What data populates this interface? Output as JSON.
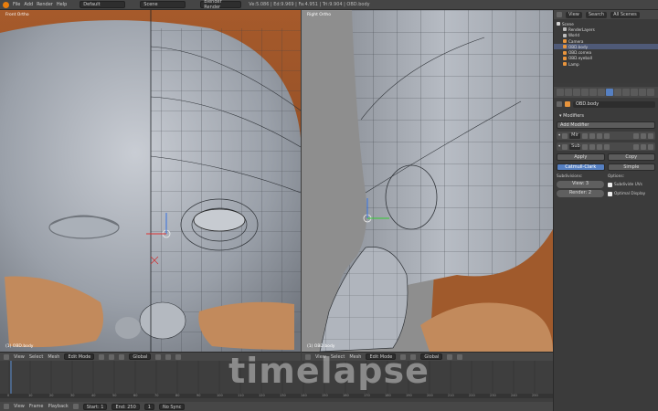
{
  "topbar": {
    "menus": [
      "File",
      "Add",
      "Render",
      "Help"
    ],
    "layout": "Default",
    "scene": "Scene",
    "engine": "Blender Render",
    "stats": "Ve:5.086 | Ed:9.969 | Fa:4.951 | Tri:9.904 | OBD.body"
  },
  "left_view": {
    "label": "Front Ortho",
    "object": "(1) OBD.body"
  },
  "right_view": {
    "label": "Right Ortho",
    "object": "(1) OBD.body"
  },
  "view_header": {
    "menus": [
      "View",
      "Select",
      "Mesh"
    ],
    "mode": "Edit Mode",
    "orientation": "Global"
  },
  "timeline": {
    "overlay": "timelapse",
    "ruler": [
      "0",
      "10",
      "20",
      "30",
      "40",
      "50",
      "60",
      "70",
      "80",
      "90",
      "100",
      "110",
      "120",
      "130",
      "140",
      "150",
      "160",
      "170",
      "180",
      "190",
      "200",
      "210",
      "220",
      "230",
      "240",
      "250"
    ],
    "menus": [
      "View",
      "Frame",
      "Playback"
    ],
    "start": "Start: 1",
    "end": "End: 250",
    "current": "1",
    "sync": "No Sync"
  },
  "outliner": {
    "tabs": [
      "View",
      "Search",
      "All Scenes"
    ],
    "items": [
      {
        "label": "Scene",
        "indent": 0,
        "color": "#d3d3d3"
      },
      {
        "label": "RenderLayers",
        "indent": 1,
        "color": "#bbbbbb"
      },
      {
        "label": "World",
        "indent": 1,
        "color": "#bbbbbb"
      },
      {
        "label": "Camera",
        "indent": 1,
        "color": "#e8943c"
      },
      {
        "label": "OBD.body",
        "indent": 1,
        "color": "#e8943c"
      },
      {
        "label": "OBD.cornea",
        "indent": 1,
        "color": "#e8943c"
      },
      {
        "label": "OBD.eyeball",
        "indent": 1,
        "color": "#e8943c"
      },
      {
        "label": "Lamp",
        "indent": 1,
        "color": "#e8943c"
      }
    ]
  },
  "properties": {
    "object_name": "OBD.body",
    "modifiers_title": "Modifiers",
    "add_modifier": "Add Modifier",
    "mod1_name": "Mir",
    "mod2_name": "Sub",
    "apply": "Apply",
    "copy": "Copy",
    "catmull": "Catmull-Clark",
    "simple": "Simple",
    "subdivisions": "Subdivisions:",
    "view_levels": "View: 3",
    "render_levels": "Render: 2",
    "options": "Options:",
    "subdivide_uvs": "Subdivide UVs",
    "optimal_display": "Optimal Display"
  }
}
